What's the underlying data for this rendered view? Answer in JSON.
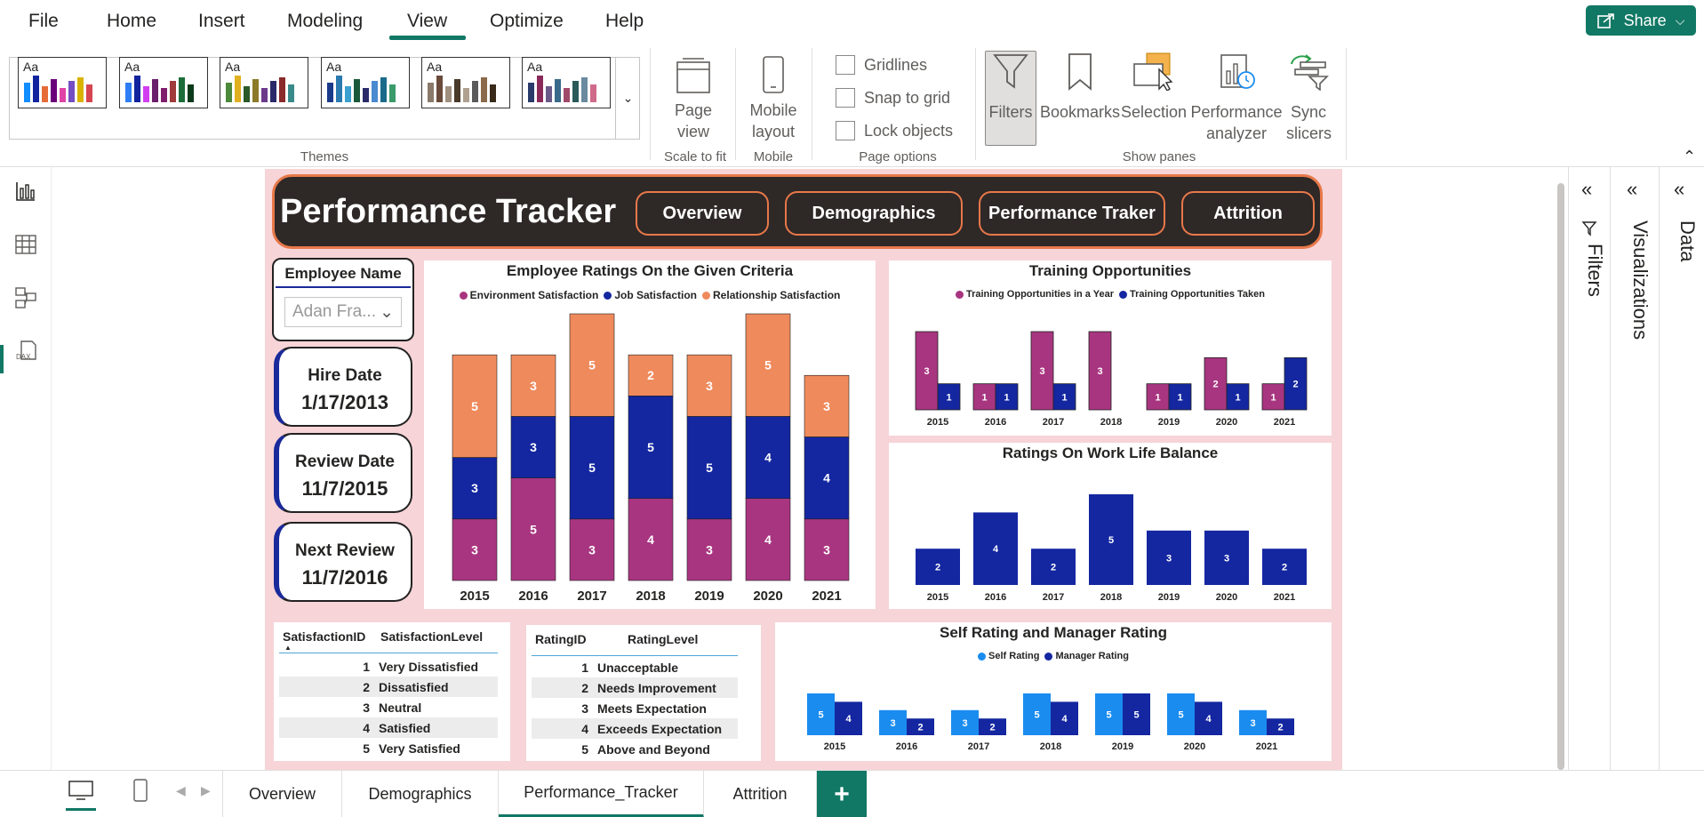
{
  "menu": {
    "tabs": [
      "File",
      "Home",
      "Insert",
      "Modeling",
      "View",
      "Optimize",
      "Help"
    ],
    "active": "View",
    "share_label": "Share"
  },
  "ribbon": {
    "themes_label": "Themes",
    "theme_aa": "Aa",
    "theme_palettes": [
      [
        "#118dff",
        "#12239e",
        "#e66c37",
        "#6b007b",
        "#e044a7",
        "#744ec2",
        "#d9b300",
        "#d64550"
      ],
      [
        "#2f7df6",
        "#12239e",
        "#d13df0",
        "#6b1e6b",
        "#7e1d6b",
        "#a13a3a",
        "#1c6d3a",
        "#0a3a1a"
      ],
      [
        "#4b8a3a",
        "#e0b020",
        "#2a5a2a",
        "#8a7a2a",
        "#6b3a8a",
        "#2a2a6a",
        "#8a2a2a",
        "#3a8a8a"
      ],
      [
        "#1a3a8a",
        "#2a7ab0",
        "#3aa0d0",
        "#1a5a3a",
        "#2a2a6a",
        "#4a8ad0",
        "#1a6a8a",
        "#3a9a6a"
      ],
      [
        "#8a7a6a",
        "#6a4a3a",
        "#a09080",
        "#4a3a2a",
        "#b0a090",
        "#5a5a5a",
        "#8a6a4a",
        "#3a2a1a"
      ],
      [
        "#2a3a6a",
        "#8a2a5a",
        "#6a5a8a",
        "#3a6a8a",
        "#a04a6a",
        "#2a5a5a",
        "#6a8aa0",
        "#d06a8a"
      ]
    ],
    "page_view": "Page view",
    "scale_to_fit": "Scale to fit",
    "mobile_layout": "Mobile layout",
    "mobile": "Mobile",
    "gridlines": "Gridlines",
    "snap_to_grid": "Snap to grid",
    "lock_objects": "Lock objects",
    "page_options": "Page options",
    "filters": "Filters",
    "bookmarks": "Bookmarks",
    "selection": "Selection",
    "performance_analyzer": "Performance analyzer",
    "sync_slicers": "Sync slicers",
    "show_panes": "Show panes"
  },
  "panes": {
    "filters": "Filters",
    "visualizations": "Visualizations",
    "data": "Data"
  },
  "page_tabs": [
    "Overview",
    "Demographics",
    "Performance_Tracker",
    "Attrition"
  ],
  "active_page": "Performance_Tracker",
  "report": {
    "title": "Performance Tracker",
    "nav": [
      "Overview",
      "Demographics",
      "Performance Traker",
      "Attrition"
    ],
    "slicer": {
      "title": "Employee Name",
      "value": "Adan Fra..."
    },
    "cards": [
      {
        "label": "Hire Date",
        "value": "1/17/2013"
      },
      {
        "label": "Review Date",
        "value": "11/7/2015"
      },
      {
        "label": "Next Review",
        "value": "11/7/2016"
      }
    ],
    "satisfaction_table": {
      "headers": [
        "SatisfactionID",
        "SatisfactionLevel"
      ],
      "rows": [
        [
          "1",
          "Very Dissatisfied"
        ],
        [
          "2",
          "Dissatisfied"
        ],
        [
          "3",
          "Neutral"
        ],
        [
          "4",
          "Satisfied"
        ],
        [
          "5",
          "Very Satisfied"
        ]
      ]
    },
    "rating_table": {
      "headers": [
        "RatingID",
        "RatingLevel"
      ],
      "rows": [
        [
          "1",
          "Unacceptable"
        ],
        [
          "2",
          "Needs Improvement"
        ],
        [
          "3",
          "Meets Expectation"
        ],
        [
          "4",
          "Exceeds Expectation"
        ],
        [
          "5",
          "Above and Beyond"
        ]
      ]
    },
    "colors": {
      "magenta": "#a83580",
      "navy": "#1427a0",
      "orange": "#ef8a5c",
      "lightblue": "#1a8cf0"
    }
  },
  "chart_data": [
    {
      "id": "criteria",
      "type": "bar",
      "stacked": true,
      "title": "Employee Ratings On the Given Criteria",
      "categories": [
        "2015",
        "2016",
        "2017",
        "2018",
        "2019",
        "2020",
        "2021"
      ],
      "series": [
        {
          "name": "Environment Satisfaction",
          "color": "#a83580",
          "values": [
            3,
            5,
            3,
            4,
            3,
            4,
            3
          ]
        },
        {
          "name": "Job Satisfaction",
          "color": "#1427a0",
          "values": [
            3,
            3,
            5,
            5,
            5,
            4,
            4
          ]
        },
        {
          "name": "Relationship Satisfaction",
          "color": "#ef8a5c",
          "values": [
            5,
            3,
            5,
            2,
            3,
            5,
            3
          ]
        }
      ],
      "ylim": [
        0,
        13
      ]
    },
    {
      "id": "training",
      "type": "bar",
      "title": "Training Opportunities",
      "categories": [
        "2015",
        "2016",
        "2017",
        "2018",
        "2019",
        "2020",
        "2021"
      ],
      "series": [
        {
          "name": "Training Opportunities in a Year",
          "color": "#a83580",
          "values": [
            3,
            1,
            3,
            3,
            1,
            2,
            1
          ]
        },
        {
          "name": "Training Opportunities Taken",
          "color": "#1427a0",
          "values": [
            1,
            1,
            1,
            0,
            1,
            1,
            2
          ]
        }
      ],
      "ylim": [
        0,
        3
      ]
    },
    {
      "id": "worklife",
      "type": "bar",
      "title": "Ratings On Work Life Balance",
      "categories": [
        "2015",
        "2016",
        "2017",
        "2018",
        "2019",
        "2020",
        "2021"
      ],
      "series": [
        {
          "color": "#1427a0",
          "values": [
            2,
            4,
            2,
            5,
            3,
            3,
            2
          ]
        }
      ],
      "ylim": [
        0,
        5
      ]
    },
    {
      "id": "selfmgr",
      "type": "bar",
      "title": "Self Rating and Manager Rating",
      "categories": [
        "2015",
        "2016",
        "2017",
        "2018",
        "2019",
        "2020",
        "2021"
      ],
      "series": [
        {
          "name": "Self Rating",
          "color": "#1a8cf0",
          "values": [
            5,
            3,
            3,
            5,
            5,
            5,
            3
          ]
        },
        {
          "name": "Manager Rating",
          "color": "#1427a0",
          "values": [
            4,
            2,
            2,
            4,
            5,
            4,
            2
          ]
        }
      ],
      "ylim": [
        0,
        5
      ]
    }
  ]
}
